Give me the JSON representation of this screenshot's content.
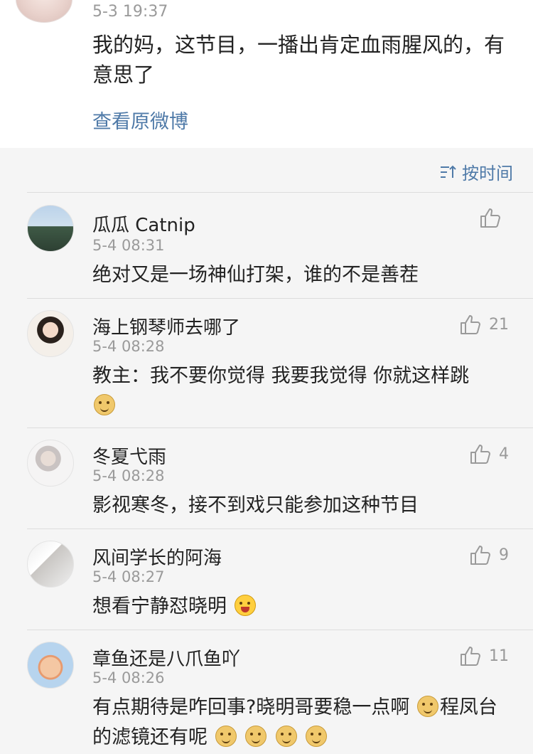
{
  "top_post": {
    "time": "5-3 19:37",
    "text": "我的妈，这节目，一播出肯定血雨腥风的，有意思了",
    "view_original": "查看原微博"
  },
  "sort": {
    "label": "按时间",
    "icon": "sort-icon"
  },
  "comments": [
    {
      "name": "瓜瓜 Catnip",
      "time": "5-4 08:31",
      "text": "绝对又是一场神仙打架，谁的不是善茬",
      "likes": ""
    },
    {
      "name": "海上钢琴师去哪了",
      "time": "5-4 08:28",
      "text": "教主：我不要你觉得 我要我觉得 你就这样跳",
      "likes": "21",
      "emoji": "doge"
    },
    {
      "name": "冬夏弋雨",
      "time": "5-4 08:28",
      "text": "影视寒冬，接不到戏只能参加这种节目",
      "likes": "4"
    },
    {
      "name": "风间学长的阿海",
      "time": "5-4 08:27",
      "text": "想看宁静怼晓明",
      "likes": "9",
      "emoji": "grin"
    },
    {
      "name": "章鱼还是八爪鱼吖",
      "time": "5-4 08:26",
      "text_a": "有点期待是咋回事?晓明哥要稳一点啊",
      "text_b": "程凤台的滤镜还有呢",
      "likes": "11",
      "emoji": "doge"
    }
  ],
  "colors": {
    "link": "#4f7aa8",
    "meta": "#9a9a9a",
    "background": "#f5f5f5"
  }
}
